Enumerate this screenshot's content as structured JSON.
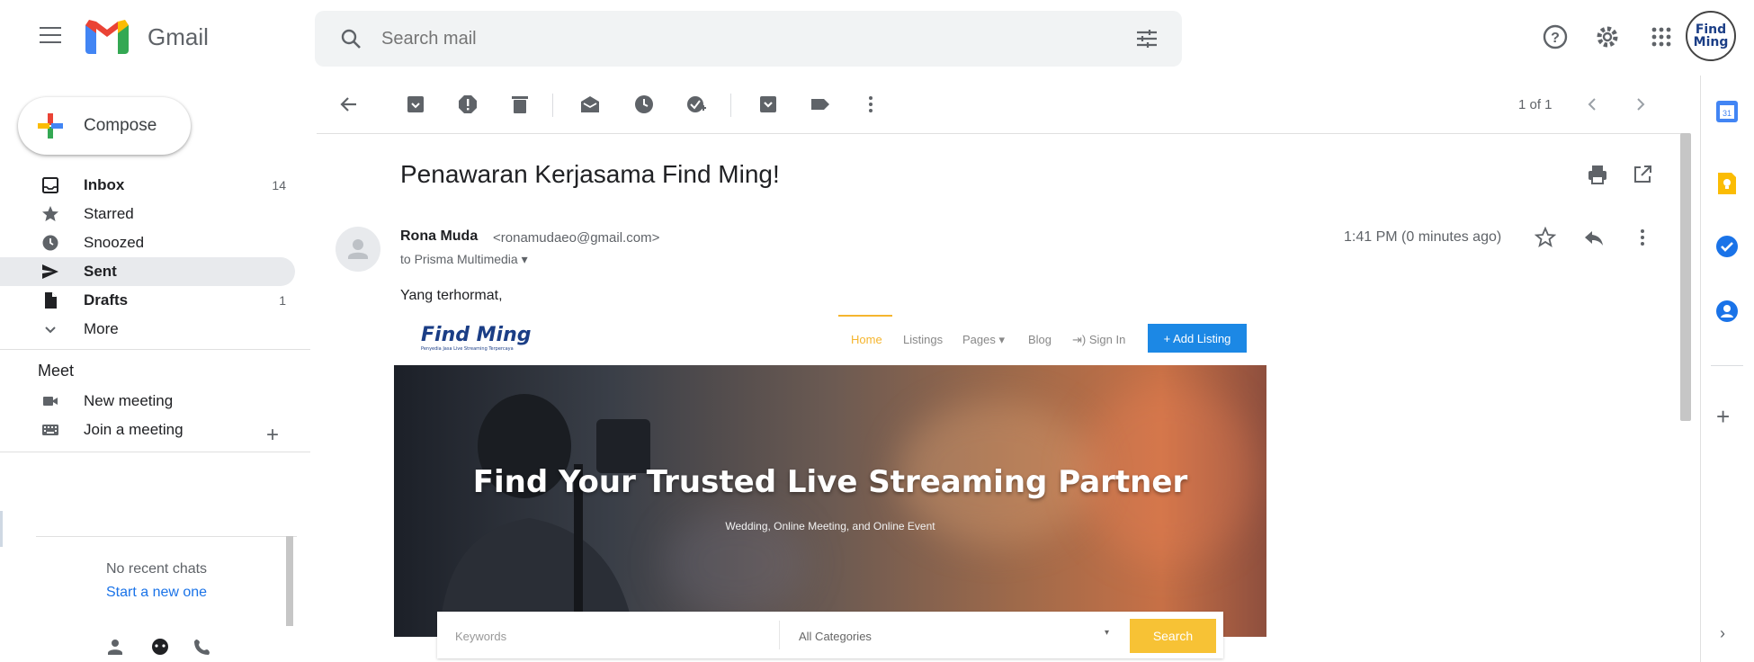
{
  "app": {
    "name": "Gmail"
  },
  "search": {
    "placeholder": "Search mail"
  },
  "profile": {
    "avatar_text": "Find Ming"
  },
  "compose": {
    "label": "Compose"
  },
  "nav": {
    "items": [
      {
        "label": "Inbox",
        "count": "14",
        "bold": true
      },
      {
        "label": "Starred",
        "count": ""
      },
      {
        "label": "Snoozed",
        "count": ""
      },
      {
        "label": "Sent",
        "count": "",
        "bold": true
      },
      {
        "label": "Drafts",
        "count": "1",
        "bold": true
      },
      {
        "label": "More",
        "count": ""
      }
    ]
  },
  "meet": {
    "title": "Meet",
    "new_meeting": "New meeting",
    "join_meeting": "Join a meeting"
  },
  "chat": {
    "no_recent": "No recent chats",
    "start_new": "Start a new one"
  },
  "toolbar": {
    "pager": "1 of 1"
  },
  "email": {
    "subject": "Penawaran Kerjasama Find Ming!",
    "sender_name": "Rona Muda",
    "sender_email": "<ronamudaeo@gmail.com>",
    "to_line": "to Prisma Multimedia",
    "time": "1:41 PM (0 minutes ago)",
    "greeting": "Yang terhormat,"
  },
  "findming": {
    "logo": "Find Ming",
    "tagline": "Penyedia Jasa Live Streaming Terpercaya",
    "nav": {
      "home": "Home",
      "listings": "Listings",
      "pages": "Pages ▾",
      "blog": "Blog",
      "signin": "⇥) Sign In"
    },
    "add_listing": "+ Add Listing",
    "hero_title": "Find Your Trusted Live Streaming Partner",
    "hero_sub": "Wedding, Online Meeting, and Online Event",
    "search": {
      "keywords": "Keywords",
      "categories": "All Categories",
      "button": "Search"
    }
  },
  "colors": {
    "accent_blue": "#1a73e8",
    "gmail_red": "#ea4335",
    "findming_yellow": "#f7c235",
    "findming_blue": "#1c88e5"
  }
}
